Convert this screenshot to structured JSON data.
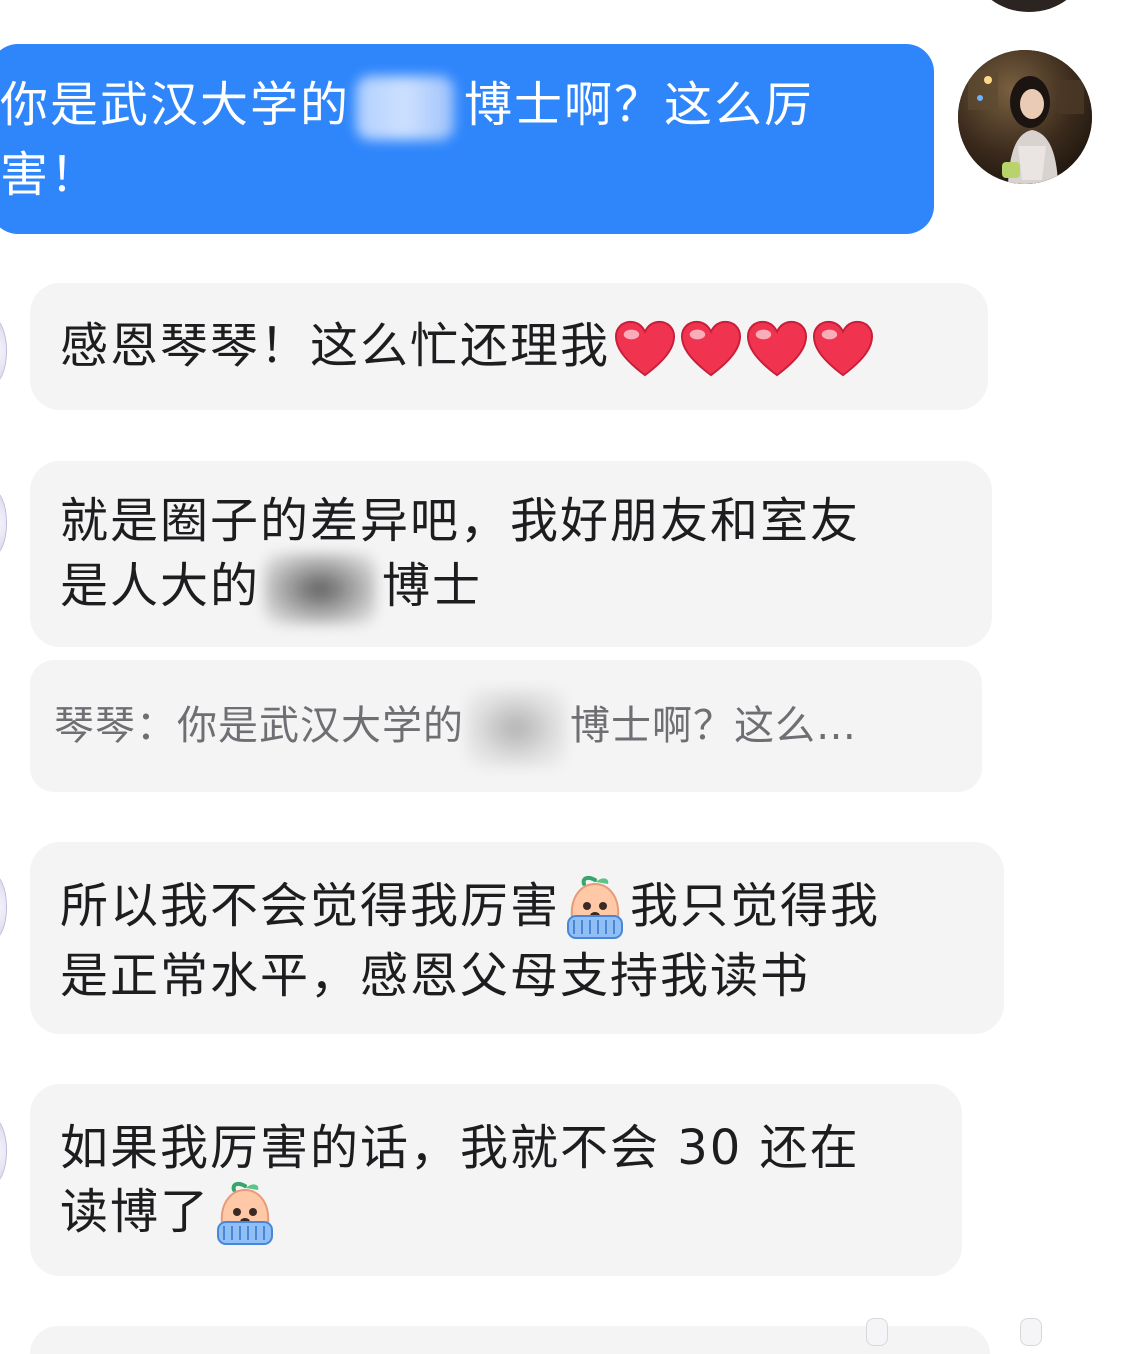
{
  "conversation": {
    "outgoing": {
      "part1": "你是武汉大学的",
      "part2": "博士啊？这么厉",
      "part3": "害！"
    },
    "msg1": {
      "text": "感恩琴琴！这么忙还理我"
    },
    "msg2": {
      "line1": "就是圈子的差异吧，我好朋友和室友",
      "line2a": "是人大的",
      "line2b": "博士"
    },
    "quote": {
      "author": "琴琴：",
      "part1": "你是武汉大学的",
      "part2": "博士啊？这么…"
    },
    "msg3": {
      "line1a": "所以我不会觉得我厉害",
      "line1b": "我只觉得我",
      "line2": "是正常水平，感恩父母支持我读书"
    },
    "msg4": {
      "line1": "如果我厉害的话，我就不会 30 还在",
      "line2": "读博了"
    }
  },
  "colors": {
    "outgoing_bubble": "#2f86fb",
    "incoming_bubble": "#f4f4f5",
    "heart": "#f0334f"
  },
  "icons": {
    "heart": "red-heart-icon",
    "crying": "crying-peach-emoji-icon"
  }
}
